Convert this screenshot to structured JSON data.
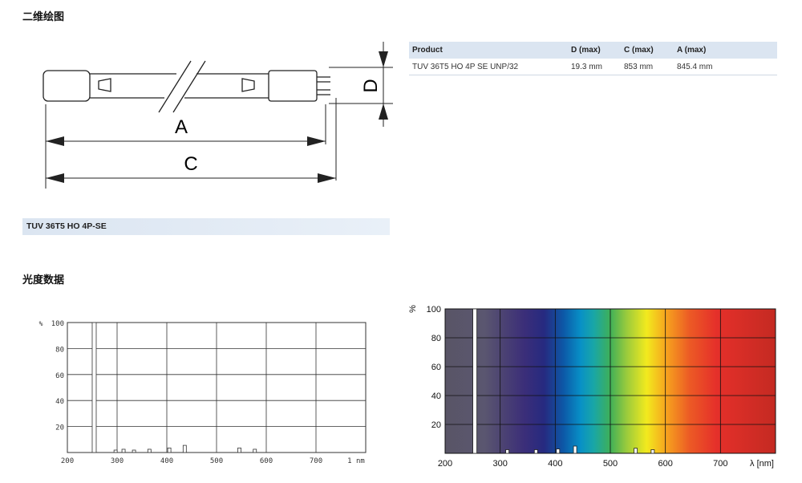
{
  "headings": {
    "dimensions": "二维绘图",
    "photometric": "光度数据"
  },
  "drawing": {
    "label_a": "A",
    "label_c": "C",
    "label_d": "D"
  },
  "spec_table": {
    "columns": [
      "Product",
      "D (max)",
      "C (max)",
      "A (max)"
    ],
    "rows": [
      [
        "TUV 36T5 HO 4P SE UNP/32",
        "19.3 mm",
        "853 mm",
        "845.4 mm"
      ]
    ]
  },
  "variant_label": "TUV 36T5 HO 4P-SE",
  "chart_data": [
    {
      "type": "bar",
      "x_ticks": [
        "200",
        "300",
        "400",
        "500",
        "600",
        "700"
      ],
      "x_unit": "1 nm",
      "y_ticks": [
        "20",
        "40",
        "60",
        "80",
        "100"
      ],
      "y_unit": "%",
      "xlim": [
        200,
        800
      ],
      "ylim": [
        0,
        100
      ],
      "grid": true,
      "series": [
        {
          "x": [
            254,
            297,
            313,
            334,
            365,
            405,
            436,
            546,
            577
          ],
          "values": [
            100,
            0.5,
            2.5,
            0.5,
            2.5,
            3.5,
            5.5,
            3.5,
            2.5
          ]
        }
      ]
    },
    {
      "type": "bar",
      "x_ticks": [
        "200",
        "300",
        "400",
        "500",
        "600",
        "700"
      ],
      "x_unit": "λ [nm]",
      "y_ticks": [
        "20",
        "40",
        "60",
        "80",
        "100"
      ],
      "y_unit": "%",
      "xlim": [
        200,
        800
      ],
      "ylim": [
        0,
        100
      ],
      "grid": true,
      "background": "visible-spectrum",
      "series": [
        {
          "x": [
            254,
            313,
            365,
            405,
            436,
            546,
            577
          ],
          "values": [
            100,
            2.5,
            2.5,
            3,
            5,
            3.5,
            2.5
          ]
        }
      ]
    }
  ]
}
